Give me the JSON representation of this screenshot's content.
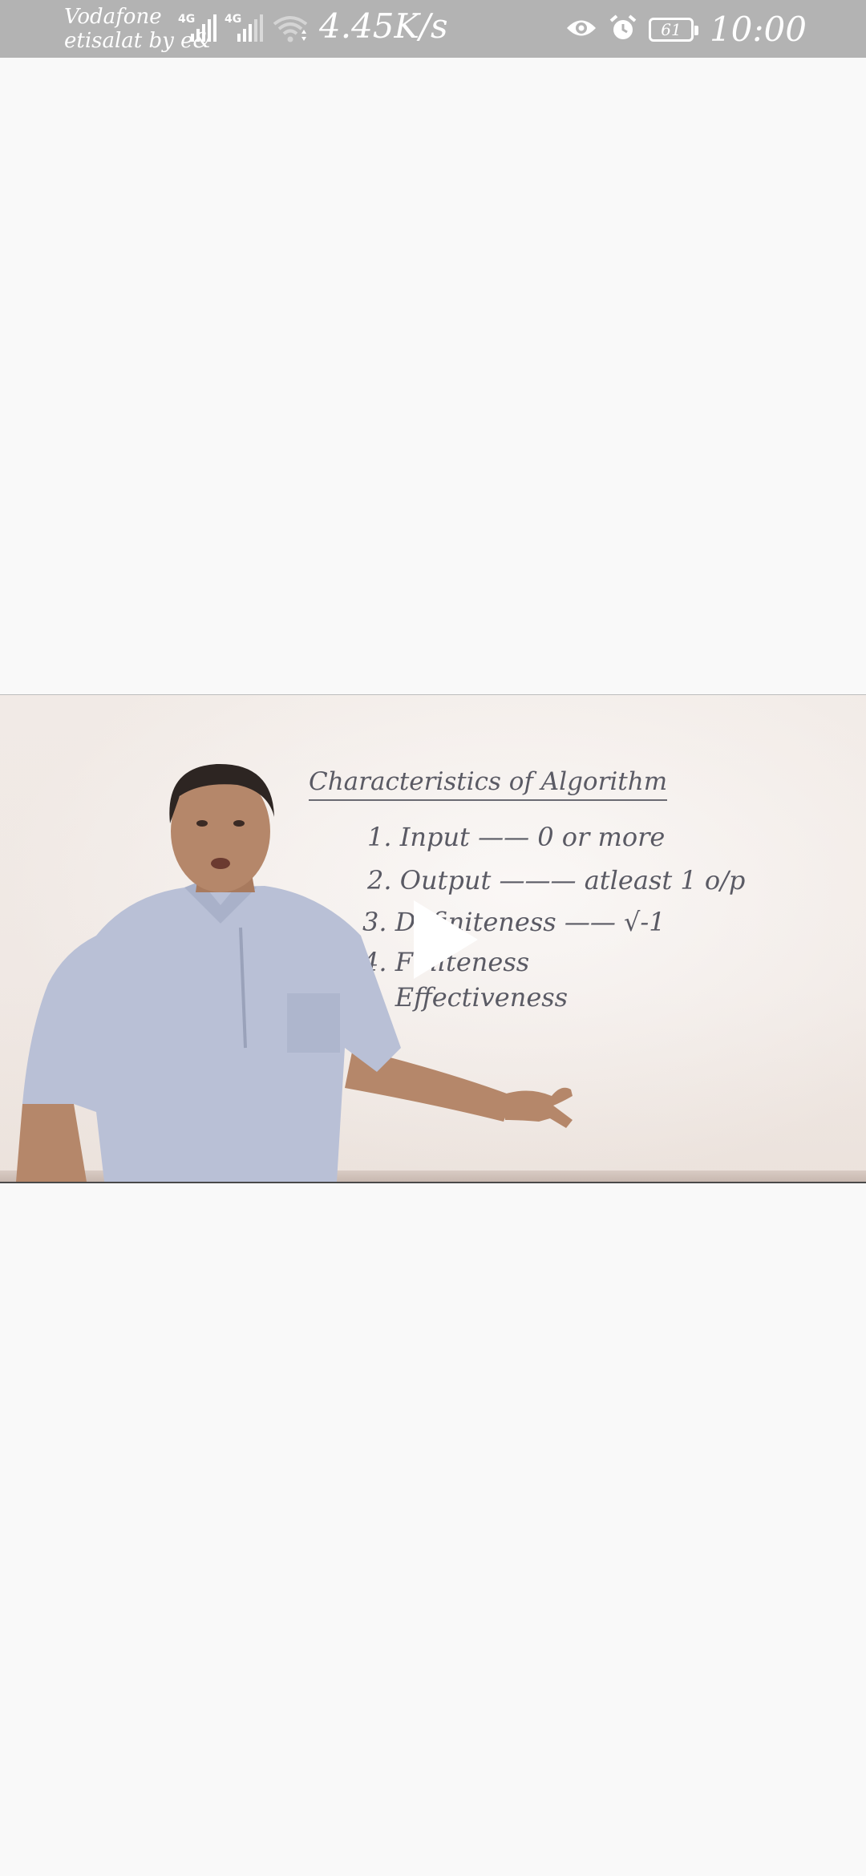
{
  "status_bar": {
    "carrier_line1": "Vodafone",
    "carrier_line2": "etisalat by e&",
    "sim1_tag": "4G",
    "sim2_tag": "4G",
    "net_speed": "4.45K/s",
    "battery_level": "61",
    "time": "10:00",
    "icons": [
      "signal-icon",
      "signal-icon",
      "wifi-icon",
      "eye-icon",
      "alarm-icon",
      "battery-icon"
    ]
  },
  "video": {
    "board_title": "Characteristics of Algorithm",
    "board_lines": [
      "1. Input  ——  0 or more",
      "2. Output  ———  atleast 1 o/p",
      "3. Definiteness  ——  √-1",
      "4. Finiteness",
      "5. Effectiveness"
    ],
    "controls": {
      "play_icon": "play-icon"
    },
    "colors": {
      "board": "#f4eeea",
      "marker": "#5a5a64",
      "shirt": "#b9c0d6"
    }
  },
  "colors": {
    "status_bar": "#b3b3b3",
    "page_background": "#f9f9f9"
  }
}
